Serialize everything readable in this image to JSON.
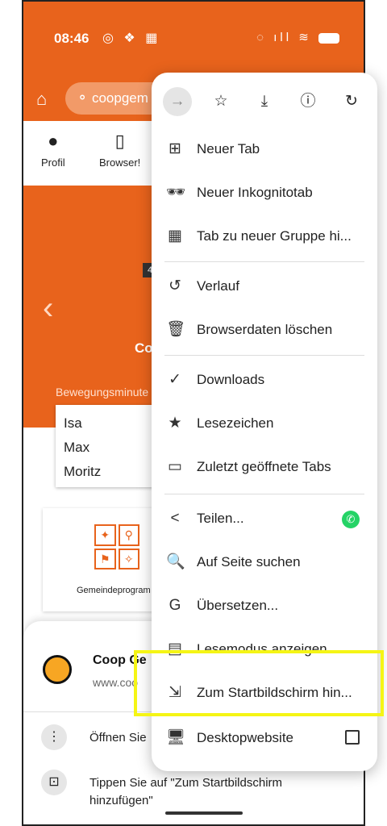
{
  "status": {
    "time": "08:46",
    "left_icons": "◎ ❖ ▦",
    "right_icons": "◌ ıll ≋"
  },
  "browser": {
    "url_text": "⚬ coopgem"
  },
  "nav": {
    "profile": "Profil",
    "browser": "Browser!"
  },
  "page": {
    "title_fragment": "Co",
    "badge": "4",
    "section_label": "Bewegungsminute",
    "names": [
      "Isa",
      "Max",
      "Moritz"
    ],
    "card_caption": "Gemeindeprogram"
  },
  "sheet": {
    "app_title": "Coop Ge",
    "app_url": "www.coo",
    "row1": "Öffnen Sie",
    "row2": "Tippen Sie auf \"Zum Startbildschirm hinzufügen\""
  },
  "menu": {
    "toolbar_icons": [
      "→",
      "☆",
      "⤓",
      "ⓘ",
      "↻"
    ],
    "items": [
      {
        "label": "Neuer Tab",
        "icon": "⊞"
      },
      {
        "label": "Neuer Inkognitotab",
        "icon": "🕶"
      },
      {
        "label": "Tab zu neuer Gruppe hi...",
        "icon": "▦"
      },
      {
        "label": "Verlauf",
        "icon": "↺"
      },
      {
        "label": "Browserdaten löschen",
        "icon": "🗑"
      },
      {
        "label": "Downloads",
        "icon": "✓"
      },
      {
        "label": "Lesezeichen",
        "icon": "★"
      },
      {
        "label": "Zuletzt geöffnete Tabs",
        "icon": "▭"
      },
      {
        "label": "Teilen...",
        "icon": "<"
      },
      {
        "label": "Auf Seite suchen",
        "icon": "🔍"
      },
      {
        "label": "Übersetzen...",
        "icon": "G"
      },
      {
        "label": "Lesemodus anzeigen",
        "icon": "▤"
      },
      {
        "label": "Zum Startbildschirm hin...",
        "icon": "⇲"
      },
      {
        "label": "Desktopwebsite",
        "icon": "🖥"
      }
    ]
  },
  "colors": {
    "brand": "#e8631c",
    "highlight": "#f5f515",
    "whatsapp": "#25d366"
  }
}
